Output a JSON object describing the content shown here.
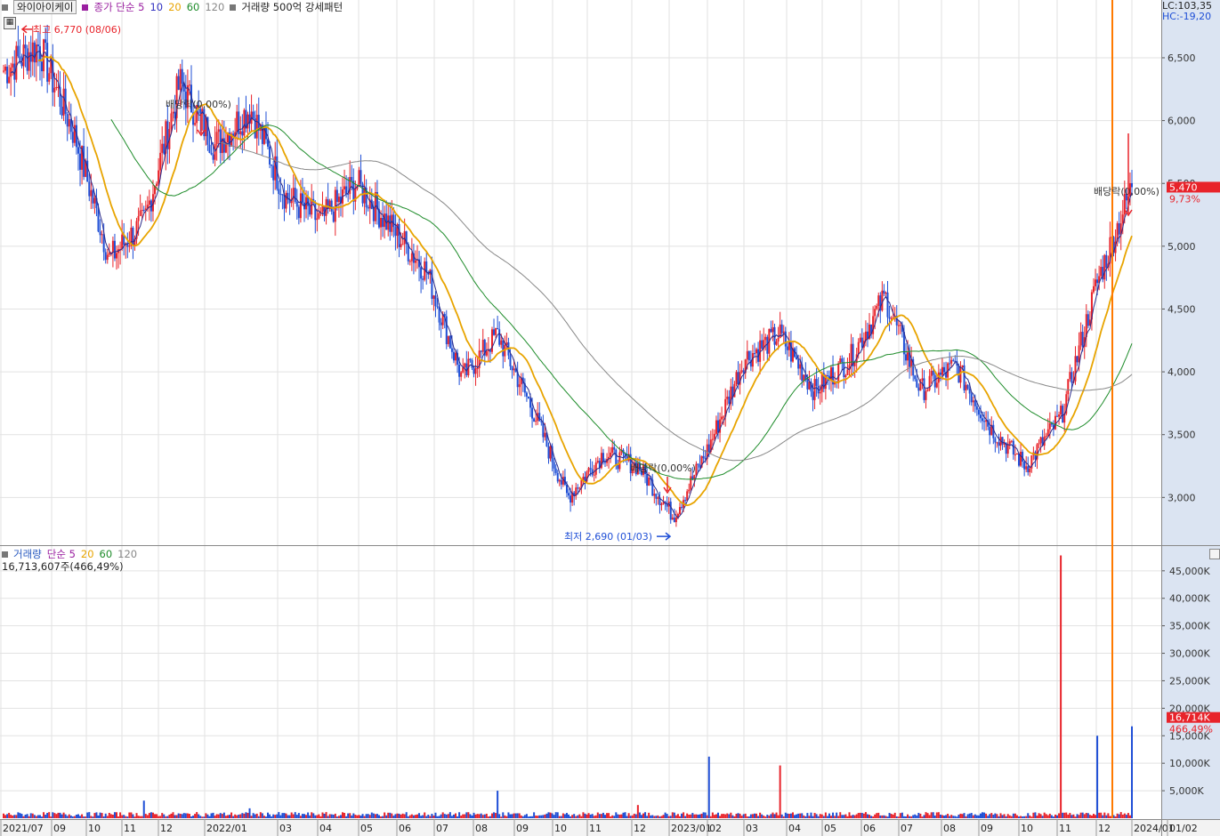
{
  "colors": {
    "up": "#e8232a",
    "down": "#1f4fd6",
    "ma5": "#2a2a8a",
    "ma20": "#e8a400",
    "ma60": "#1e8c2a",
    "ma120": "#888888",
    "vol_ma5": "#c03cc0",
    "marker": "#ff7a00",
    "axis_bg": "#dbe4f2",
    "grid": "#e2e2e2"
  },
  "price_legend": {
    "name": "와이아이케이",
    "items": [
      {
        "label": "종가 단순 5",
        "color": "#9a1fa0"
      },
      {
        "label": "10",
        "color": "#3030c0"
      },
      {
        "label": "20",
        "color": "#e8a400"
      },
      {
        "label": "60",
        "color": "#1e8c2a"
      },
      {
        "label": "120",
        "color": "#888888"
      },
      {
        "label": "거래량 500억 강세패턴",
        "color": "#222222"
      }
    ]
  },
  "volume_legend": {
    "items": [
      {
        "label": "거래량",
        "color": "#2a5bc0"
      },
      {
        "label": "단순 5",
        "color": "#9a1fa0"
      },
      {
        "label": "20",
        "color": "#e8a400"
      },
      {
        "label": "60",
        "color": "#1e8c2a"
      },
      {
        "label": "120",
        "color": "#888888"
      }
    ],
    "summary": "16,713,607주(466,49%)"
  },
  "right_header": {
    "lc": "LC:103,35",
    "hc": "HC:-19,20"
  },
  "annotations": {
    "high": "최고 6,770 (08/06)",
    "low": "최저 2,690 (01/03)",
    "dividend": "배당락(0,00%)",
    "current_price": "5,470",
    "current_change": "9,73%",
    "current_volume": "16,714K",
    "volume_change": "466,49%"
  },
  "chart_data": [
    {
      "type": "candlestick",
      "title": "와이아이케이",
      "x_labels": [
        "2021/07",
        "09",
        "10",
        "11",
        "12",
        "2022/01",
        "03",
        "04",
        "05",
        "06",
        "07",
        "08",
        "09",
        "10",
        "11",
        "12",
        "2023/01",
        "02",
        "03",
        "04",
        "05",
        "06",
        "07",
        "08",
        "09",
        "10",
        "11",
        "12",
        "2024/01",
        "01/02"
      ],
      "yticks": [
        3000,
        3500,
        4000,
        4500,
        5000,
        5500,
        6000,
        6500
      ],
      "ytick_labels": [
        "3,000",
        "3,500",
        "4,000",
        "4,500",
        "5,000",
        "5,500",
        "6,000",
        "6,500"
      ],
      "ylim": [
        2620,
        6960
      ],
      "close_trend": [
        {
          "month": "2021/07",
          "close": 6400
        },
        {
          "month": "2021/08",
          "close": 6600
        },
        {
          "month": "2021/09",
          "close": 5900
        },
        {
          "month": "2021/10",
          "close": 4900
        },
        {
          "month": "2021/11",
          "close": 5200
        },
        {
          "month": "2021/11b",
          "close": 6300
        },
        {
          "month": "2021/12",
          "close": 5800
        },
        {
          "month": "2022/01",
          "close": 6100
        },
        {
          "month": "2022/02",
          "close": 5400
        },
        {
          "month": "2022/03",
          "close": 5200
        },
        {
          "month": "2022/04",
          "close": 5500
        },
        {
          "month": "2022/05",
          "close": 5150
        },
        {
          "month": "2022/06",
          "close": 4800
        },
        {
          "month": "2022/07",
          "close": 3950
        },
        {
          "month": "2022/08",
          "close": 4300
        },
        {
          "month": "2022/09",
          "close": 3700
        },
        {
          "month": "2022/10",
          "close": 3000
        },
        {
          "month": "2022/11",
          "close": 3350
        },
        {
          "month": "2022/12",
          "close": 3250
        },
        {
          "month": "2023/01",
          "close": 2850
        },
        {
          "month": "2023/02",
          "close": 3400
        },
        {
          "month": "2023/03",
          "close": 4100
        },
        {
          "month": "2023/04",
          "close": 4300
        },
        {
          "month": "2023/05",
          "close": 3850
        },
        {
          "month": "2023/06",
          "close": 4100
        },
        {
          "month": "2023/07",
          "close": 4600
        },
        {
          "month": "2023/08",
          "close": 3850
        },
        {
          "month": "2023/09",
          "close": 4050
        },
        {
          "month": "2023/10",
          "close": 3550
        },
        {
          "month": "2023/11",
          "close": 3250
        },
        {
          "month": "2023/12",
          "close": 3650
        },
        {
          "month": "2023/12b",
          "close": 4700
        },
        {
          "month": "2024/01",
          "close": 5470
        }
      ],
      "high": {
        "value": 6770,
        "date": "08/06"
      },
      "low": {
        "value": 2690,
        "date": "01/03"
      },
      "last_close": 5470,
      "last_change_pct": 9.73
    },
    {
      "type": "bar",
      "title": "거래량",
      "yticks": [
        5000,
        10000,
        15000,
        20000,
        25000,
        30000,
        35000,
        40000,
        45000
      ],
      "ytick_labels": [
        "5,000K",
        "10,000K",
        "15,000K",
        "20,000K",
        "25,000K",
        "30,000K",
        "35,000K",
        "40,000K",
        "45,000K"
      ],
      "ylim": [
        0,
        49500
      ],
      "unit": "K",
      "base_volume_k": 700,
      "spikes": [
        {
          "month": "2021/11",
          "volume_k": 3200
        },
        {
          "month": "2022/01",
          "volume_k": 1800
        },
        {
          "month": "2022/08",
          "volume_k": 5000
        },
        {
          "month": "2022/12",
          "volume_k": 2400
        },
        {
          "month": "2023/02",
          "volume_k": 11200
        },
        {
          "month": "2023/04",
          "volume_k": 9600
        },
        {
          "month": "2023/12",
          "volume_k": 47800
        },
        {
          "month": "2023/12b",
          "volume_k": 15000
        },
        {
          "month": "2024/01",
          "volume_k": 16714
        }
      ],
      "last_volume": 16713607,
      "last_change_pct": 466.49
    }
  ]
}
